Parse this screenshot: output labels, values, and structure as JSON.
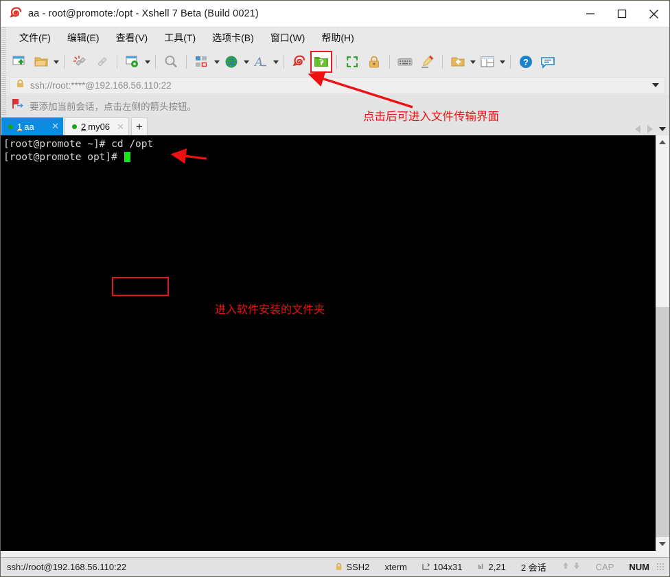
{
  "window": {
    "title": "aa - root@promote:/opt - Xshell 7 Beta (Build 0021)",
    "logo_icon": "xshell-logo-icon",
    "controls": {
      "minimize": "minimize-icon",
      "maximize": "maximize-icon",
      "close": "close-icon"
    }
  },
  "menubar": {
    "items": [
      {
        "label": "文件(F)"
      },
      {
        "label": "编辑(E)"
      },
      {
        "label": "查看(V)"
      },
      {
        "label": "工具(T)"
      },
      {
        "label": "选项卡(B)"
      },
      {
        "label": "窗口(W)"
      },
      {
        "label": "帮助(H)"
      }
    ]
  },
  "toolbar": {
    "items": [
      {
        "name": "new-session-icon",
        "caret": false
      },
      {
        "name": "open-folder-icon",
        "caret": true
      },
      {
        "name": "disconnect-icon",
        "caret": false
      },
      {
        "name": "reconnect-link-icon",
        "caret": false
      },
      {
        "name": "session-properties-icon",
        "caret": true
      },
      {
        "name": "find-icon",
        "caret": false
      },
      {
        "name": "layout-arrange-icon",
        "caret": true
      },
      {
        "name": "globe-icon",
        "caret": true
      },
      {
        "name": "font-icon",
        "caret": true
      },
      {
        "name": "xshell-icon",
        "caret": false
      },
      {
        "name": "xftp-file-transfer-icon",
        "caret": false,
        "highlighted": true
      },
      {
        "name": "fullscreen-icon",
        "caret": false
      },
      {
        "name": "lock-icon",
        "caret": false
      },
      {
        "name": "keyboard-icon",
        "caret": false
      },
      {
        "name": "highlight-pen-icon",
        "caret": false
      },
      {
        "name": "add-folder-icon",
        "caret": true
      },
      {
        "name": "split-view-icon",
        "caret": true
      },
      {
        "name": "help-icon",
        "caret": false
      },
      {
        "name": "chat-bubble-icon",
        "caret": false
      }
    ]
  },
  "address_bar": {
    "lock_icon": "lock-icon",
    "value": "ssh://root:****@192.168.56.110:22",
    "dropdown_icon": "chevron-down-icon"
  },
  "hint_bar": {
    "icon": "flag-arrow-icon",
    "text": "要添加当前会话，点击左侧的箭头按钮。"
  },
  "tabs": {
    "items": [
      {
        "number": "1",
        "label": "aa",
        "active": true,
        "status": "connected"
      },
      {
        "number": "2",
        "label": "my06",
        "active": false,
        "status": "connected"
      }
    ],
    "new_tab_label": "+",
    "close_label": "✕",
    "nav": {
      "prev_icon": "chevron-left-icon",
      "next_icon": "chevron-right-icon",
      "list_icon": "chevron-down-icon"
    }
  },
  "terminal": {
    "lines": [
      {
        "prompt": "[root@promote ~]# ",
        "command": "cd /opt",
        "boxed": true
      },
      {
        "prompt": "[root@promote opt]# ",
        "command": "",
        "cursor": true
      }
    ],
    "scrollbar": {
      "up_icon": "scroll-up-icon",
      "down_icon": "scroll-down-icon"
    }
  },
  "annotations": [
    {
      "name": "annotation-file-transfer",
      "text": "点击后可进入文件传输界面",
      "color": "#ef1111"
    },
    {
      "name": "annotation-enter-folder",
      "text": "进入软件安装的文件夹",
      "color": "#ef1111"
    }
  ],
  "statusbar": {
    "connection": "ssh://root@192.168.56.110:22",
    "protocol": "SSH2",
    "terminal_type": "xterm",
    "size": "104x31",
    "cursor_position": "2,21",
    "sessions": "2 会话",
    "cap": "CAP",
    "num": "NUM",
    "icons": {
      "lock": "lock-icon",
      "size": "terminal-size-icon",
      "cursor": "cursor-position-icon",
      "up": "transfer-up-icon",
      "down": "transfer-down-icon",
      "grip": "resize-grip-icon"
    }
  },
  "colors": {
    "accent": "#0c8ce0",
    "annotation": "#ef1111",
    "terminal_bg": "#000000",
    "terminal_fg": "#d8d8d8",
    "cursor": "#19e619",
    "status_ok": "#16a616"
  }
}
